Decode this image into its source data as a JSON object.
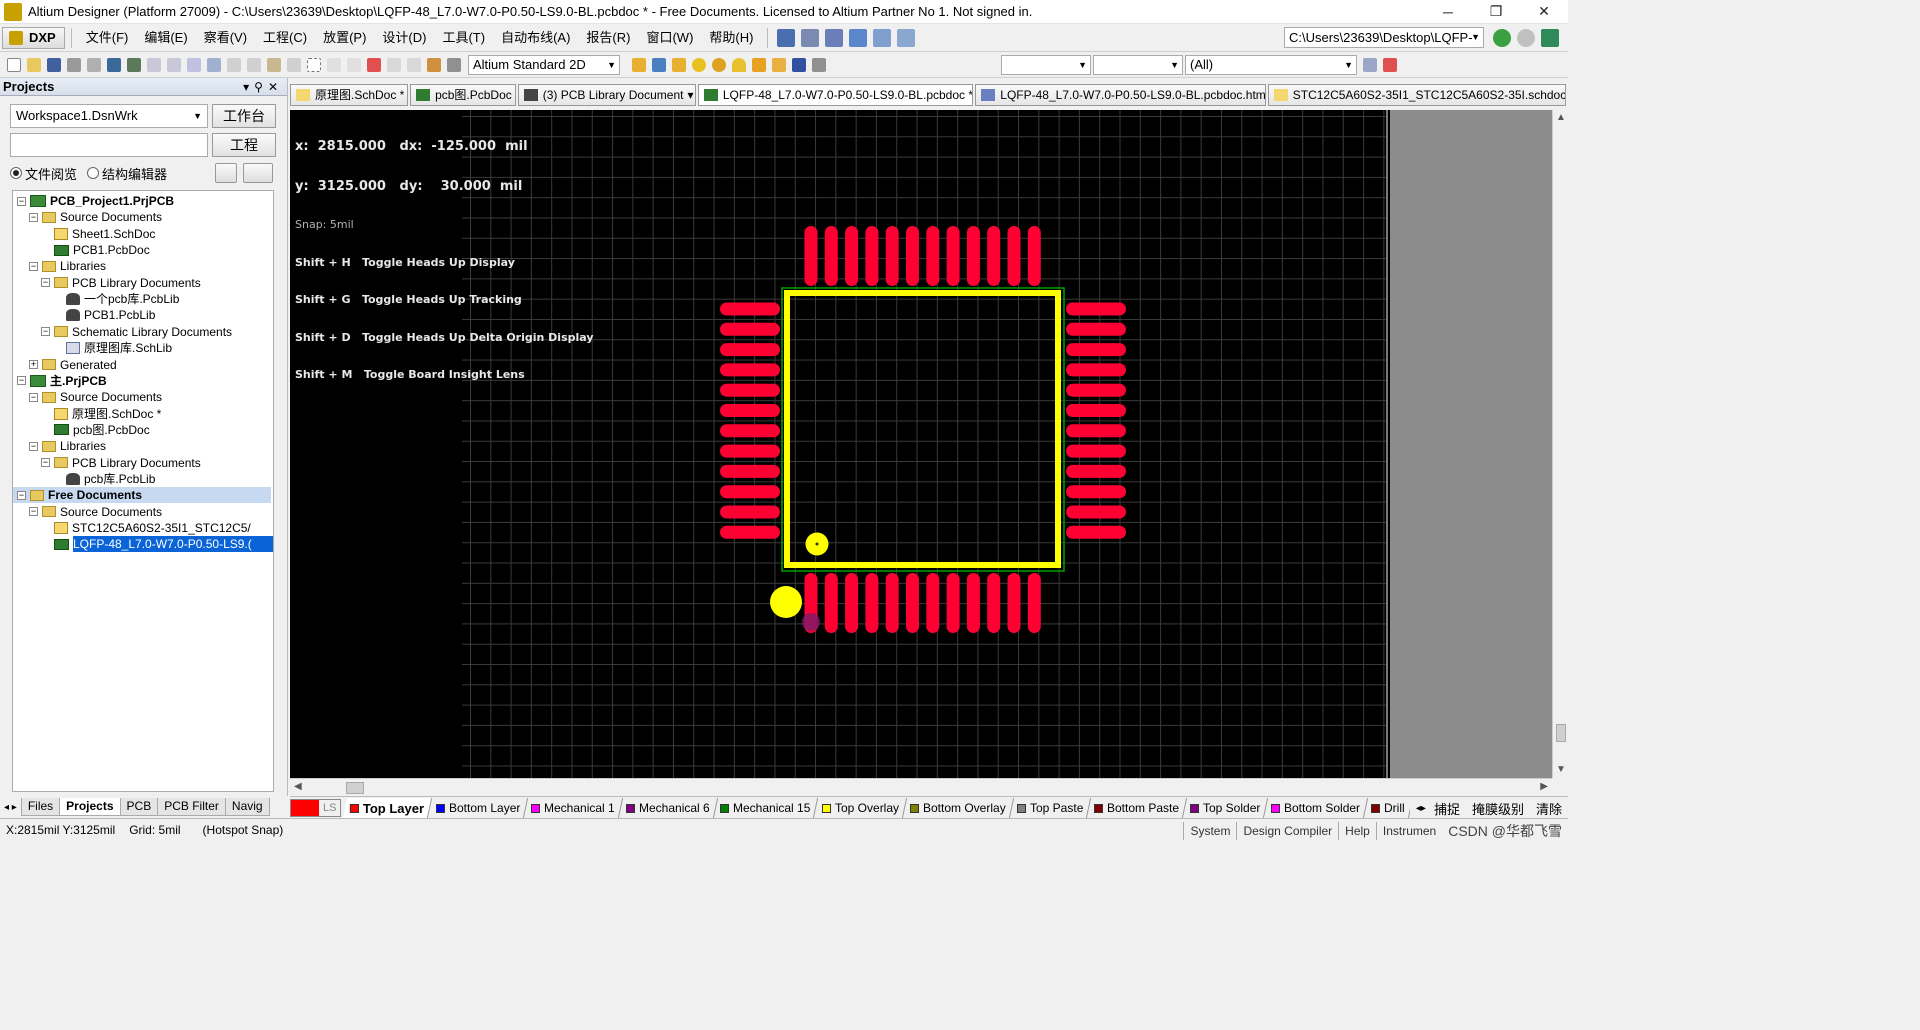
{
  "window": {
    "title": "Altium Designer (Platform 27009) - C:\\Users\\23639\\Desktop\\LQFP-48_L7.0-W7.0-P0.50-LS9.0-BL.pcbdoc * - Free Documents. Licensed to Altium Partner No 1. Not signed in.",
    "controls": [
      "─",
      "❐",
      "✕"
    ]
  },
  "menubar": {
    "dxp": "DXP",
    "items": [
      "文件(F)",
      "编辑(E)",
      "察看(V)",
      "工程(C)",
      "放置(P)",
      "设计(D)",
      "工具(T)",
      "自动布线(A)",
      "报告(R)",
      "窗口(W)",
      "帮助(H)"
    ],
    "path": "C:\\Users\\23639\\Desktop\\LQFP-"
  },
  "toolbar2": {
    "view_mode": "Altium Standard 2D",
    "filter_all": "(All)"
  },
  "projects_panel": {
    "title": "Projects",
    "workspace": "Workspace1.DsnWrk",
    "workspace_btn": "工作台",
    "project_btn": "工程",
    "radio_file_view": "文件阅览",
    "radio_struct_editor": "结构编辑器",
    "tree": [
      {
        "label": "PCB_Project1.PrjPCB",
        "icon": "project-icon",
        "level": 0,
        "expander": "⊟",
        "bold": true
      },
      {
        "label": "Source Documents",
        "icon": "folder-icon",
        "level": 1,
        "expander": "⊟"
      },
      {
        "label": "Sheet1.SchDoc",
        "icon": "schematic-icon",
        "level": 2,
        "expander": ""
      },
      {
        "label": "PCB1.PcbDoc",
        "icon": "pcb-icon",
        "level": 2,
        "expander": ""
      },
      {
        "label": "Libraries",
        "icon": "folder-icon",
        "level": 1,
        "expander": "⊟"
      },
      {
        "label": "PCB Library Documents",
        "icon": "folder-icon",
        "level": 2,
        "expander": "⊟"
      },
      {
        "label": "一个pcb库.PcbLib",
        "icon": "pcblib-icon",
        "level": 3,
        "expander": ""
      },
      {
        "label": "PCB1.PcbLib",
        "icon": "pcblib-icon",
        "level": 3,
        "expander": ""
      },
      {
        "label": "Schematic Library Documents",
        "icon": "folder-icon",
        "level": 2,
        "expander": "⊟"
      },
      {
        "label": "原理图库.SchLib",
        "icon": "schlib-icon",
        "level": 3,
        "expander": ""
      },
      {
        "label": "Generated",
        "icon": "folder-icon",
        "level": 1,
        "expander": "⊞"
      },
      {
        "label": "主.PrjPCB",
        "icon": "project-icon",
        "level": 0,
        "expander": "⊟",
        "bold": true
      },
      {
        "label": "Source Documents",
        "icon": "folder-icon",
        "level": 1,
        "expander": "⊟"
      },
      {
        "label": "原理图.SchDoc *",
        "icon": "schematic-icon",
        "level": 2,
        "expander": ""
      },
      {
        "label": "pcb图.PcbDoc",
        "icon": "pcb-icon",
        "level": 2,
        "expander": ""
      },
      {
        "label": "Libraries",
        "icon": "folder-icon",
        "level": 1,
        "expander": "⊟"
      },
      {
        "label": "PCB Library Documents",
        "icon": "folder-icon",
        "level": 2,
        "expander": "⊟"
      },
      {
        "label": "pcb库.PcbLib",
        "icon": "pcblib-icon",
        "level": 3,
        "expander": ""
      },
      {
        "label": "Free Documents",
        "icon": "folder-icon",
        "level": 0,
        "expander": "⊟",
        "bold": true,
        "selected": "gray"
      },
      {
        "label": "Source Documents",
        "icon": "folder-icon",
        "level": 1,
        "expander": "⊟"
      },
      {
        "label": "STC12C5A60S2-35I1_STC12C5/",
        "icon": "schematic-icon",
        "level": 2,
        "expander": ""
      },
      {
        "label": "LQFP-48_L7.0-W7.0-P0.50-LS9.(",
        "icon": "pcb-icon",
        "level": 2,
        "expander": "",
        "selected": "blue"
      }
    ],
    "bottom_tabs": [
      "Files",
      "Projects",
      "PCB",
      "PCB Filter",
      "Navig"
    ]
  },
  "doc_tabs": [
    {
      "label": "原理图.SchDoc *",
      "icon": "schematic-icon",
      "color": "#f5d770"
    },
    {
      "label": "pcb图.PcbDoc",
      "icon": "pcb-icon",
      "color": "#2f7b2f"
    },
    {
      "label": "(3) PCB Library Document",
      "icon": "pcblib-icon",
      "color": "#444444",
      "dropdown": "▾"
    },
    {
      "label": "LQFP-48_L7.0-W7.0-P0.50-LS9.0-BL.pcbdoc *",
      "icon": "pcb-icon",
      "color": "#2f7b2f",
      "active": true
    },
    {
      "label": "LQFP-48_L7.0-W7.0-P0.50-LS9.0-BL.pcbdoc.htm",
      "icon": "html-icon",
      "color": "#6a7fbf"
    },
    {
      "label": "STC12C5A60S2-35I1_STC12C5A60S2-35I.schdoc",
      "icon": "schematic-icon",
      "color": "#f5d770"
    }
  ],
  "hud": {
    "x_line": "x:  2815.000   dx:  -125.000  mil",
    "y_line": "y:  3125.000   dy:    30.000  mil",
    "snap": "Snap: 5mil",
    "hints": [
      "Shift + H   Toggle Heads Up Display",
      "Shift + G   Toggle Heads Up Tracking",
      "Shift + D   Toggle Heads Up Delta Origin Display",
      "Shift + M   Toggle Board Insight Lens"
    ]
  },
  "footprint": {
    "name": "LQFP-48",
    "pads_per_side": 12,
    "pad_color": "#ff0033",
    "outline_color": "#ffff00",
    "courtyard_color": "#00a000",
    "pin1_marker_color": "#ffff00"
  },
  "layer_tabs": {
    "ls_label": "LS",
    "ls_color": "#ff0000",
    "layers": [
      {
        "name": "Top Layer",
        "color": "#ff0000",
        "active": true
      },
      {
        "name": "Bottom Layer",
        "color": "#0000ff"
      },
      {
        "name": "Mechanical 1",
        "color": "#ff00ff"
      },
      {
        "name": "Mechanical 6",
        "color": "#800080"
      },
      {
        "name": "Mechanical 15",
        "color": "#008000"
      },
      {
        "name": "Top Overlay",
        "color": "#ffff00"
      },
      {
        "name": "Bottom Overlay",
        "color": "#808000"
      },
      {
        "name": "Top Paste",
        "color": "#808080"
      },
      {
        "name": "Bottom Paste",
        "color": "#800000"
      },
      {
        "name": "Top Solder",
        "color": "#800080"
      },
      {
        "name": "Bottom Solder",
        "color": "#ff00ff"
      },
      {
        "name": "Drill",
        "color": "#800000"
      }
    ],
    "right": [
      "捕捉",
      "掩膜级别",
      "清除"
    ]
  },
  "statusbar": {
    "coords": "X:2815mil Y:3125mil",
    "grid": "Grid: 5mil",
    "snap": "(Hotspot Snap)",
    "buttons": [
      "System",
      "Design Compiler",
      "Help",
      "Instrumen"
    ],
    "watermark": "CSDN @华都飞雪"
  }
}
